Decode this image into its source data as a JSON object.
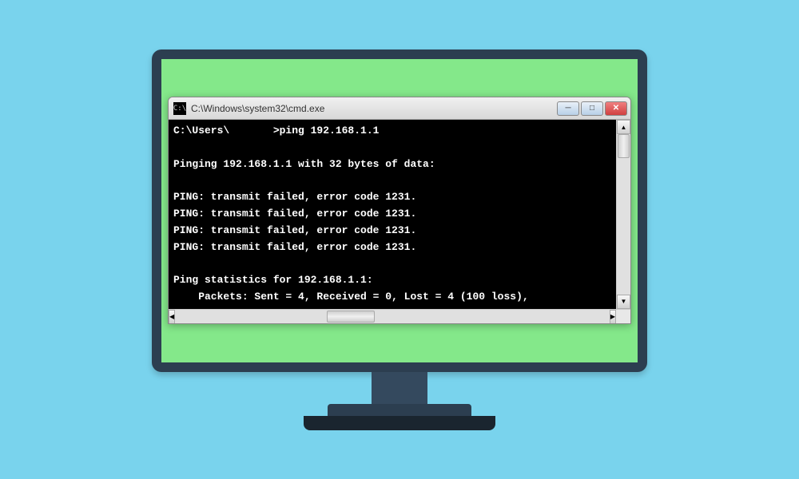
{
  "window": {
    "title": "C:\\Windows\\system32\\cmd.exe",
    "icon_label": "C:\\"
  },
  "console": {
    "prompt": "C:\\Users\\",
    "command": "ping 192.168.1.1",
    "lines": [
      "C:\\Users\\       >ping 192.168.1.1",
      "",
      "Pinging 192.168.1.1 with 32 bytes of data:",
      "",
      "PING: transmit failed, error code 1231.",
      "PING: transmit failed, error code 1231.",
      "PING: transmit failed, error code 1231.",
      "PING: transmit failed, error code 1231.",
      "",
      "Ping statistics for 192.168.1.1:",
      "    Packets: Sent = 4, Received = 0, Lost = 4 (100 loss),"
    ]
  },
  "buttons": {
    "minimize": "─",
    "maximize": "□",
    "close": "✕"
  },
  "scroll": {
    "up": "▲",
    "down": "▼",
    "left": "◀",
    "right": "▶"
  }
}
